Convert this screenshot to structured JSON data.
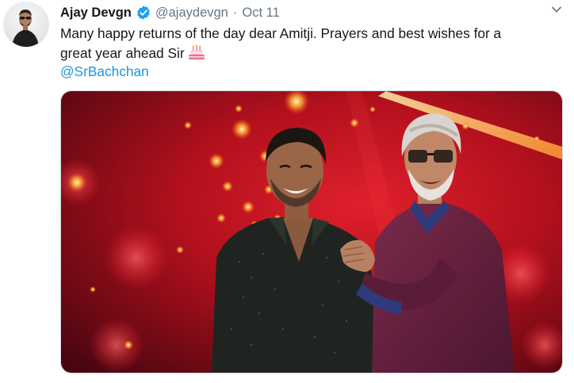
{
  "tweet": {
    "author": {
      "name": "Ajay Devgn",
      "handle": "@ajaydevgn",
      "verified": true,
      "avatar_icon": "profile-avatar"
    },
    "separator": "·",
    "date": "Oct 11",
    "text_line1": "Many happy returns of the day dear Amitji. Prayers and best wishes for a",
    "text_line2": "great year ahead Sir",
    "emoji": "birthday-cake-icon",
    "mention": "@SrBachchan",
    "menu_icon": "chevron-down-icon",
    "media": {
      "type": "photo",
      "icon": "tweet-photo"
    }
  },
  "colors": {
    "text": "#14171a",
    "secondary": "#657786",
    "link": "#1b95e0",
    "verified": "#1da1f2",
    "stage_red": "#c1121f"
  }
}
